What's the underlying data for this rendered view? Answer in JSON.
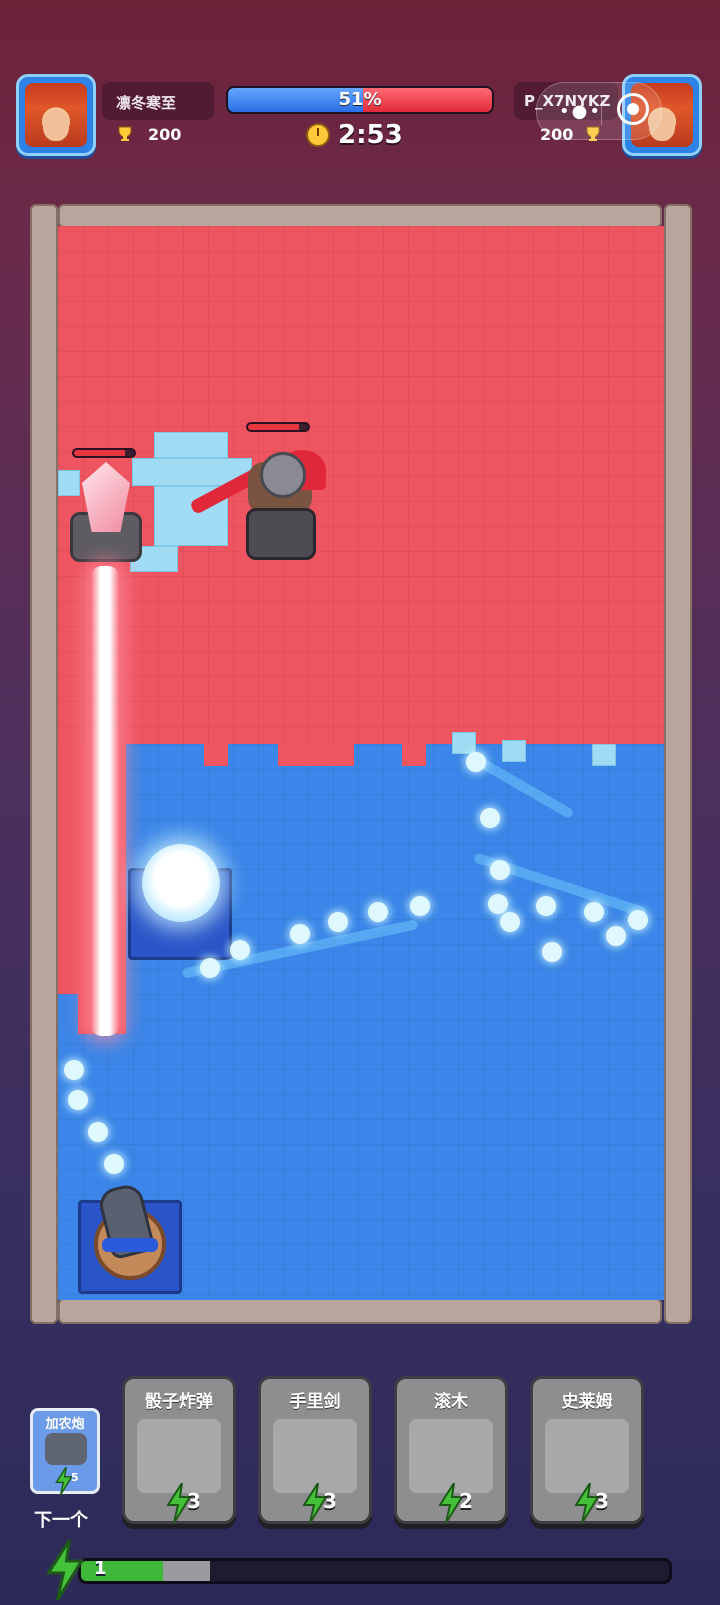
{
  "players": {
    "left": {
      "name": "凛冬寒至",
      "trophies": "200"
    },
    "right": {
      "name": "P_X7NYKZ",
      "trophies": "200"
    }
  },
  "battle": {
    "territory_percent": "51%",
    "territory_blue_fraction": 0.51,
    "timer": "2:53"
  },
  "colors": {
    "blue_team": "#3b86e8",
    "red_team": "#ee5560",
    "elixir": "#3fb83a"
  },
  "cards": [
    {
      "name": "骰子炸弹",
      "cost": "3",
      "icon": "dice-icon"
    },
    {
      "name": "手里剑",
      "cost": "3",
      "icon": "shuriken-icon"
    },
    {
      "name": "滚木",
      "cost": "2",
      "icon": "log-icon"
    },
    {
      "name": "史莱姆",
      "cost": "3",
      "icon": "slime-icon"
    }
  ],
  "next_card": {
    "name": "加农炮",
    "cost": "5",
    "label": "下一个"
  },
  "elixir": {
    "count": "1",
    "fraction": 0.22
  },
  "icons": {
    "trophy": "trophy-icon",
    "clock": "stopwatch-icon",
    "menu": "more-dots-icon",
    "record": "record-target-icon",
    "elixir": "lightning-bolt-icon"
  }
}
